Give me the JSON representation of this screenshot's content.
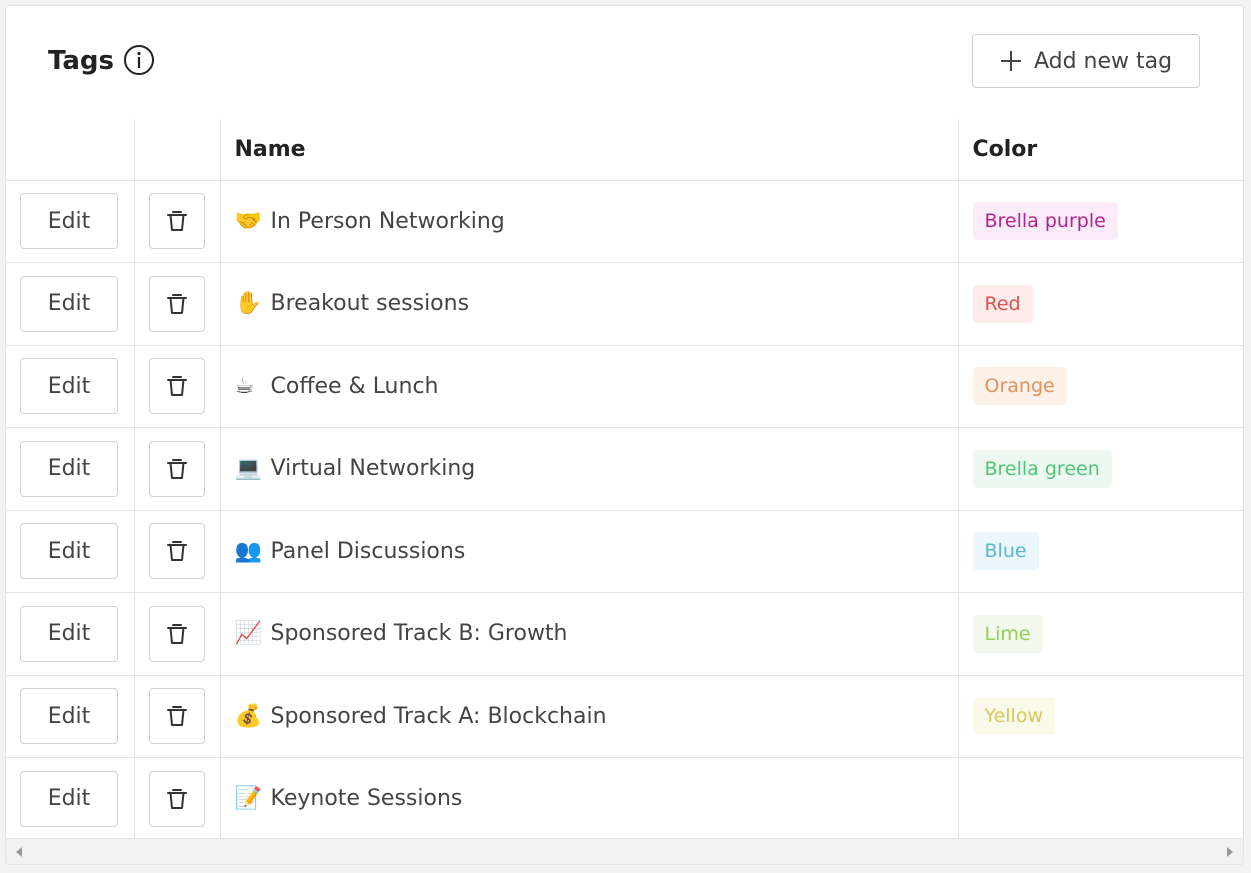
{
  "header": {
    "title": "Tags",
    "add_button_label": "Add new tag"
  },
  "table": {
    "columns": [
      "",
      "",
      "Name",
      "Color"
    ],
    "edit_label": "Edit",
    "rows": [
      {
        "emoji": "🤝",
        "name": "In Person Networking",
        "color_label": "Brella purple",
        "text_color": "#b1278f",
        "bg_color": "#fbeaf7"
      },
      {
        "emoji": "✋",
        "name": "Breakout sessions",
        "color_label": "Red",
        "text_color": "#d9534f",
        "bg_color": "#fcebeb"
      },
      {
        "emoji": "☕",
        "name": "Coffee & Lunch",
        "color_label": "Orange",
        "text_color": "#e0925c",
        "bg_color": "#fdf1e8"
      },
      {
        "emoji": "💻",
        "name": "Virtual Networking",
        "color_label": "Brella green",
        "text_color": "#52c47a",
        "bg_color": "#ecf8f0"
      },
      {
        "emoji": "👥",
        "name": "Panel Discussions",
        "color_label": "Blue",
        "text_color": "#5bb6cf",
        "bg_color": "#ebf7fa"
      },
      {
        "emoji": "📈",
        "name": "Sponsored Track B: Growth",
        "color_label": "Lime",
        "text_color": "#8fcf5a",
        "bg_color": "#f2f9ec"
      },
      {
        "emoji": "💰",
        "name": "Sponsored Track A: Blockchain",
        "color_label": "Yellow",
        "text_color": "#d6c85a",
        "bg_color": "#fbf9ea"
      },
      {
        "emoji": "📝",
        "name": "Keynote Sessions",
        "color_label": "",
        "text_color": "#444444",
        "bg_color": "#ffffff"
      }
    ]
  },
  "icons": {
    "info": "info-icon",
    "add": "plus-icon",
    "delete": "trash-icon"
  }
}
